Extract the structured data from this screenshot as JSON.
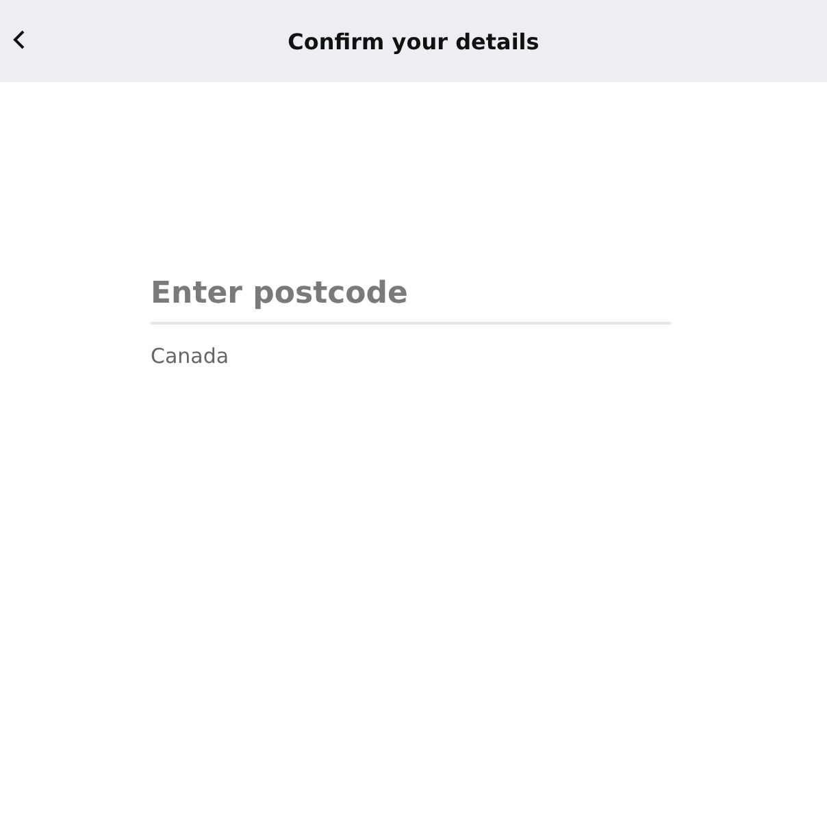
{
  "header": {
    "title": "Confirm your details"
  },
  "postcode_field": {
    "placeholder": "Enter postcode"
  },
  "country": "Canada"
}
